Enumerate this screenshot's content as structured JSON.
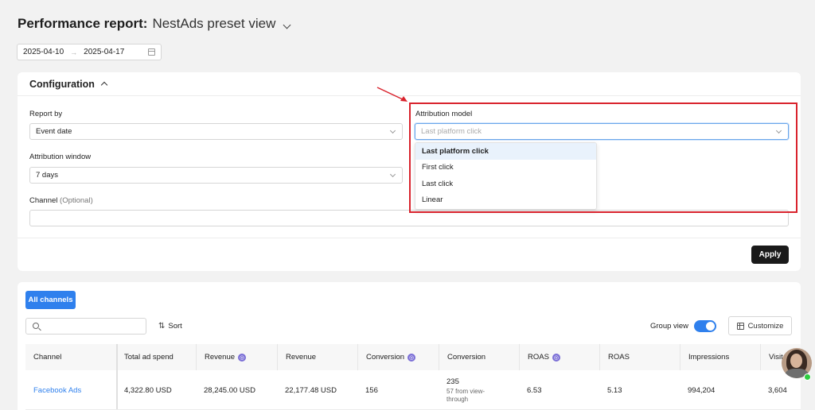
{
  "header": {
    "title_bold": "Performance report:",
    "preset_view": "NestAds preset view"
  },
  "date_range": {
    "start": "2025-04-10",
    "separator": "→",
    "end": "2025-04-17"
  },
  "config": {
    "title": "Configuration",
    "report_by": {
      "label": "Report by",
      "value": "Event date"
    },
    "attribution_window": {
      "label": "Attribution window",
      "value": "7 days"
    },
    "channel": {
      "label": "Channel",
      "optional": "(Optional)",
      "value": ""
    },
    "attribution_model": {
      "label": "Attribution model",
      "placeholder": "Last platform click",
      "options": [
        "Last platform click",
        "First click",
        "Last click",
        "Linear"
      ],
      "selected": "Last platform click"
    },
    "apply_label": "Apply"
  },
  "table": {
    "tab_label": "All channels",
    "sort_label": "Sort",
    "group_view_label": "Group view",
    "group_view_on": true,
    "customize_label": "Customize",
    "columns": [
      "Channel",
      "Total ad spend",
      "Revenue",
      "Revenue",
      "Conversion",
      "Conversion",
      "ROAS",
      "ROAS",
      "Impressions",
      "Visit"
    ],
    "rows": [
      {
        "channel": "Facebook Ads",
        "total_ad_spend": "4,322.80 USD",
        "revenue_a": "28,245.00 USD",
        "revenue_b": "22,177.48 USD",
        "conversion_a": "156",
        "conversion_b": "235",
        "conversion_b_sub": "57 from view-through",
        "roas_a": "6.53",
        "roas_b": "5.13",
        "impressions": "994,204",
        "visits": "3,604"
      }
    ]
  },
  "colors": {
    "accent": "#2f80ed",
    "highlight": "#d9232d",
    "apply_bg": "#1a1a1a"
  },
  "icons": [
    "chevron-down-icon",
    "chevron-up-icon",
    "calendar-icon",
    "search-icon",
    "sort-icon",
    "grid-icon",
    "info-badge-icon"
  ]
}
